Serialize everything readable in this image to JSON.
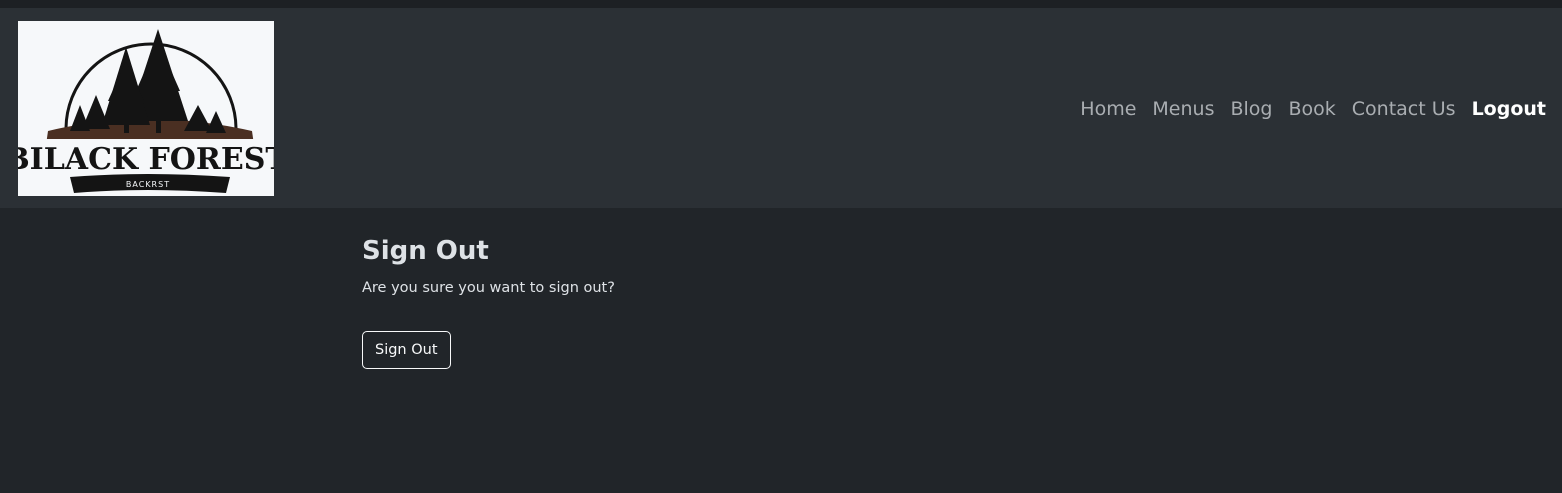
{
  "logo": {
    "alt_text": "BILACK FOREST",
    "subtitle": "BACKRST",
    "colors": {
      "background": "#f6f8fa",
      "trees": "#141414",
      "ground": "#4a2f22"
    }
  },
  "nav": {
    "items": [
      {
        "label": "Home"
      },
      {
        "label": "Menus"
      },
      {
        "label": "Blog"
      },
      {
        "label": "Book"
      },
      {
        "label": "Contact Us"
      },
      {
        "label": "Logout"
      }
    ],
    "active": "Logout"
  },
  "main": {
    "title": "Sign Out",
    "message": "Are you sure you want to sign out?",
    "button_label": "Sign Out"
  },
  "colors": {
    "page_background": "#212529",
    "navbar_background": "#2b3035",
    "nav_text": "#a9adb1",
    "nav_active_text": "#ffffff",
    "body_text": "#dee2e6"
  }
}
